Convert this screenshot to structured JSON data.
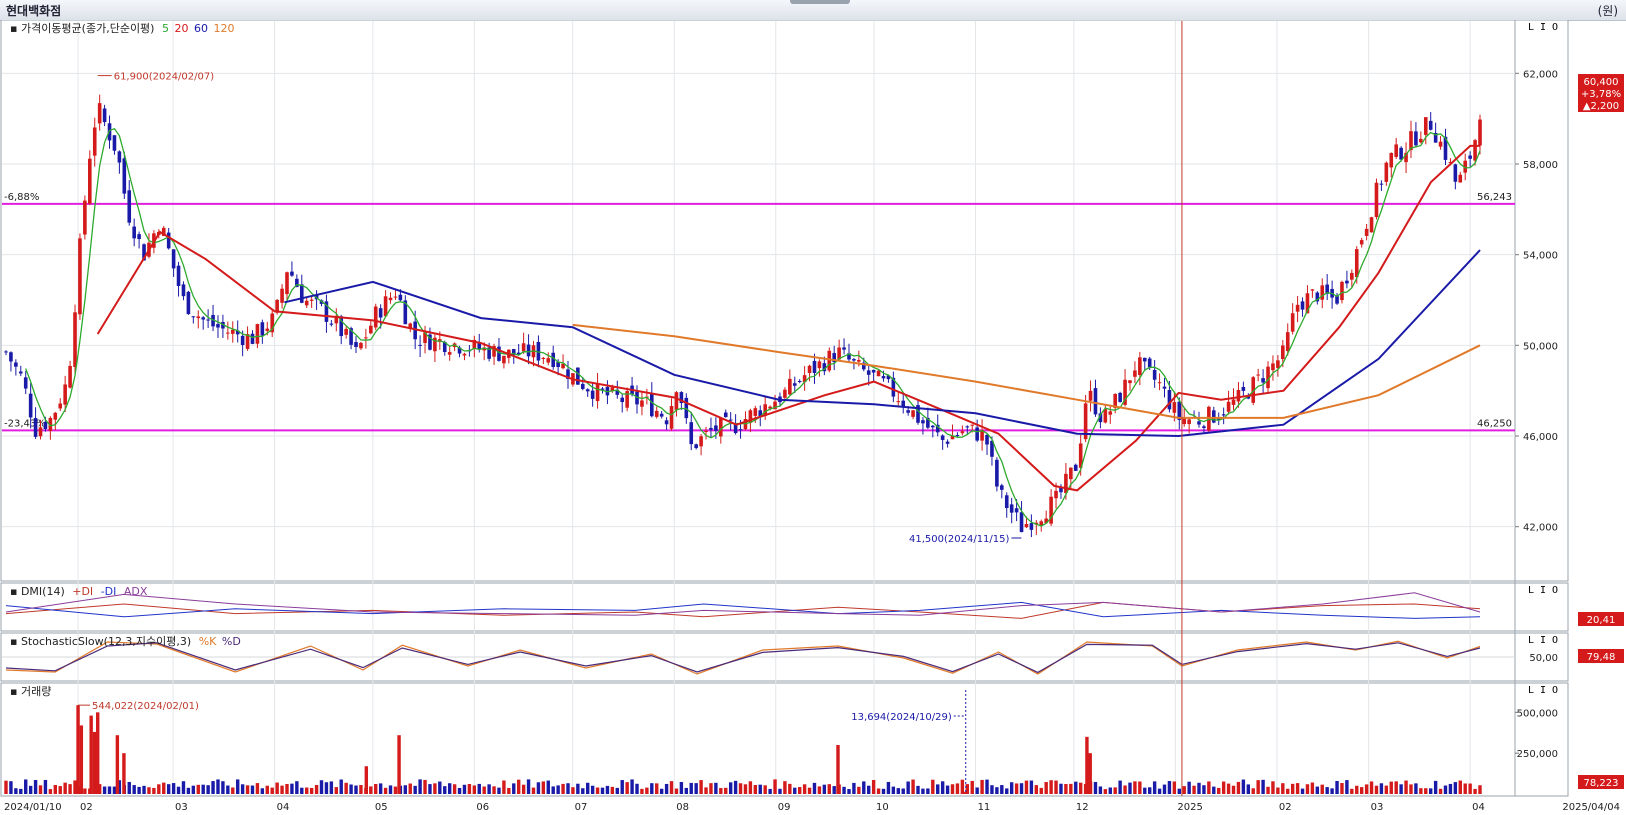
{
  "app": {
    "title": "현대백화점",
    "unit": "(원)",
    "pane_buttons": [
      "L",
      "I",
      "O"
    ]
  },
  "chart_data": {
    "type": "candlestick",
    "title": "가격이동평균(종가,단순이평)",
    "ma_periods": [
      "5",
      "20",
      "60",
      "120"
    ],
    "ma_colors": {
      "5": "#2eaa2e",
      "20": "#d41a1a",
      "60": "#1a1aa8",
      "120": "#e07a2a"
    },
    "up_color": "#d41a1a",
    "down_color": "#1a1aa8",
    "price_axis": {
      "ticks": [
        "62,000",
        "58,000",
        "54,000",
        "50,000",
        "46,000",
        "42,000"
      ],
      "ylim": [
        40000,
        64000
      ]
    },
    "x_axis": {
      "start": "2024/01/10",
      "end": "2025/04/04",
      "labels": [
        "2024/01/10",
        "02",
        "03",
        "04",
        "05",
        "06",
        "07",
        "08",
        "09",
        "10",
        "11",
        "12",
        "2025",
        "02",
        "03",
        "04",
        "2025/04/04"
      ],
      "label_dates": [
        "2024-01-10",
        "2024-02-01",
        "2024-03-01",
        "2024-04-01",
        "2024-05-01",
        "2024-06-01",
        "2024-07-01",
        "2024-08-01",
        "2024-09-01",
        "2024-10-01",
        "2024-11-01",
        "2024-12-01",
        "2025-01-01",
        "2025-02-01",
        "2025-03-01",
        "2025-04-01",
        "2025-04-04"
      ]
    },
    "price_points": [
      [
        "2024-01-10",
        49700
      ],
      [
        "2024-01-15",
        48500
      ],
      [
        "2024-01-19",
        46300
      ],
      [
        "2024-01-24",
        46800
      ],
      [
        "2024-01-29",
        48500
      ],
      [
        "2024-02-02",
        55000
      ],
      [
        "2024-02-05",
        59000
      ],
      [
        "2024-02-07",
        60500
      ],
      [
        "2024-02-13",
        58500
      ],
      [
        "2024-02-16",
        56000
      ],
      [
        "2024-02-21",
        54000
      ],
      [
        "2024-02-26",
        55500
      ],
      [
        "2024-03-04",
        52000
      ],
      [
        "2024-03-11",
        51000
      ],
      [
        "2024-03-18",
        50600
      ],
      [
        "2024-03-25",
        50300
      ],
      [
        "2024-04-01",
        51200
      ],
      [
        "2024-04-05",
        53500
      ],
      [
        "2024-04-10",
        52000
      ],
      [
        "2024-04-16",
        51500
      ],
      [
        "2024-04-22",
        50500
      ],
      [
        "2024-04-26",
        49600
      ],
      [
        "2024-05-02",
        51400
      ],
      [
        "2024-05-08",
        52400
      ],
      [
        "2024-05-14",
        50300
      ],
      [
        "2024-05-21",
        50200
      ],
      [
        "2024-05-28",
        50000
      ],
      [
        "2024-06-04",
        49800
      ],
      [
        "2024-06-11",
        49600
      ],
      [
        "2024-06-18",
        49700
      ],
      [
        "2024-06-25",
        49500
      ],
      [
        "2024-07-02",
        48500
      ],
      [
        "2024-07-09",
        47900
      ],
      [
        "2024-07-16",
        47600
      ],
      [
        "2024-07-23",
        47500
      ],
      [
        "2024-07-30",
        46800
      ],
      [
        "2024-08-02",
        48500
      ],
      [
        "2024-08-06",
        45500
      ],
      [
        "2024-08-13",
        46300
      ],
      [
        "2024-08-20",
        46500
      ],
      [
        "2024-08-27",
        47200
      ],
      [
        "2024-09-03",
        47800
      ],
      [
        "2024-09-10",
        48700
      ],
      [
        "2024-09-20",
        49700
      ],
      [
        "2024-09-27",
        48900
      ],
      [
        "2024-10-02",
        48500
      ],
      [
        "2024-10-08",
        47800
      ],
      [
        "2024-10-15",
        46700
      ],
      [
        "2024-10-22",
        45800
      ],
      [
        "2024-10-29",
        46300
      ],
      [
        "2024-11-04",
        46000
      ],
      [
        "2024-11-08",
        43500
      ],
      [
        "2024-11-15",
        42000
      ],
      [
        "2024-11-20",
        42500
      ],
      [
        "2024-11-26",
        43200
      ],
      [
        "2024-12-02",
        44800
      ],
      [
        "2024-12-05",
        48000
      ],
      [
        "2024-12-10",
        46700
      ],
      [
        "2024-12-16",
        48000
      ],
      [
        "2024-12-20",
        49200
      ],
      [
        "2024-12-27",
        48300
      ],
      [
        "2025-01-02",
        46800
      ],
      [
        "2025-01-08",
        46700
      ],
      [
        "2025-01-14",
        47000
      ],
      [
        "2025-01-21",
        47700
      ],
      [
        "2025-02-03",
        49600
      ],
      [
        "2025-02-07",
        51800
      ],
      [
        "2025-02-13",
        52300
      ],
      [
        "2025-02-19",
        52000
      ],
      [
        "2025-02-25",
        54000
      ],
      [
        "2025-03-04",
        57000
      ],
      [
        "2025-03-07",
        58200
      ],
      [
        "2025-03-12",
        58700
      ],
      [
        "2025-03-17",
        59500
      ],
      [
        "2025-03-20",
        59800
      ],
      [
        "2025-03-25",
        58300
      ],
      [
        "2025-03-28",
        57000
      ],
      [
        "2025-04-02",
        58700
      ],
      [
        "2025-04-04",
        60400
      ]
    ],
    "ma_lines": {
      "20": [
        [
          "2024-02-07",
          50500
        ],
        [
          "2024-02-26",
          55000
        ],
        [
          "2024-03-11",
          53800
        ],
        [
          "2024-04-01",
          51500
        ],
        [
          "2024-05-01",
          51100
        ],
        [
          "2024-06-03",
          50100
        ],
        [
          "2024-07-01",
          48500
        ],
        [
          "2024-08-01",
          47700
        ],
        [
          "2024-08-20",
          46500
        ],
        [
          "2024-09-16",
          47800
        ],
        [
          "2024-10-01",
          48400
        ],
        [
          "2024-10-21",
          47200
        ],
        [
          "2024-11-08",
          46100
        ],
        [
          "2024-11-25",
          43800
        ],
        [
          "2024-12-02",
          43600
        ],
        [
          "2024-12-20",
          45800
        ],
        [
          "2025-01-02",
          47900
        ],
        [
          "2025-01-15",
          47600
        ],
        [
          "2025-02-03",
          48000
        ],
        [
          "2025-02-20",
          50800
        ],
        [
          "2025-03-04",
          53200
        ],
        [
          "2025-03-20",
          57200
        ],
        [
          "2025-04-01",
          58800
        ],
        [
          "2025-04-04",
          58800
        ]
      ],
      "60": [
        [
          "2024-04-04",
          51900
        ],
        [
          "2024-05-01",
          52800
        ],
        [
          "2024-06-03",
          51200
        ],
        [
          "2024-07-01",
          50800
        ],
        [
          "2024-08-01",
          48700
        ],
        [
          "2024-09-02",
          47600
        ],
        [
          "2024-10-01",
          47400
        ],
        [
          "2024-11-01",
          47000
        ],
        [
          "2024-12-02",
          46100
        ],
        [
          "2025-01-02",
          46000
        ],
        [
          "2025-02-03",
          46500
        ],
        [
          "2025-03-04",
          49400
        ],
        [
          "2025-04-04",
          54200
        ]
      ],
      "120": [
        [
          "2024-07-01",
          50900
        ],
        [
          "2024-08-01",
          50400
        ],
        [
          "2024-09-02",
          49700
        ],
        [
          "2024-10-01",
          49100
        ],
        [
          "2024-11-01",
          48400
        ],
        [
          "2024-12-02",
          47600
        ],
        [
          "2025-01-02",
          46800
        ],
        [
          "2025-02-03",
          46800
        ],
        [
          "2025-03-04",
          47800
        ],
        [
          "2025-04-04",
          50000
        ]
      ]
    },
    "horizontal_lines": [
      {
        "value": 56243,
        "right_label": "56,243",
        "left_label": "-6,88%"
      },
      {
        "value": 46250,
        "right_label": "46,250",
        "left_label": "-23,43%"
      }
    ],
    "cursor_date": "2025-01-03",
    "annotations": {
      "high": {
        "date": "2024-02-07",
        "value": 61900,
        "text": "61,900(2024/02/07)"
      },
      "low": {
        "date": "2024-11-15",
        "value": 41500,
        "text": "41,500(2024/11/15)"
      }
    },
    "last_price_box": {
      "price": "60,400",
      "change_pct": "+3,78%",
      "change": "▲2,200"
    },
    "dmi": {
      "title": "DMI(14)",
      "series": [
        "+DI",
        "-DI",
        "ADX"
      ],
      "colors": [
        "#c0392b",
        "#2134c9",
        "#8a3d9a"
      ],
      "last_value": "20,41",
      "pdi": [
        [
          "2024-01-10",
          18
        ],
        [
          "2024-02-15",
          30
        ],
        [
          "2024-03-20",
          18
        ],
        [
          "2024-05-01",
          22
        ],
        [
          "2024-06-10",
          16
        ],
        [
          "2024-07-20",
          20
        ],
        [
          "2024-08-10",
          14
        ],
        [
          "2024-09-20",
          26
        ],
        [
          "2024-10-15",
          20
        ],
        [
          "2024-11-15",
          12
        ],
        [
          "2024-12-10",
          32
        ],
        [
          "2025-01-15",
          20
        ],
        [
          "2025-02-15",
          28
        ],
        [
          "2025-03-15",
          30
        ],
        [
          "2025-04-04",
          24
        ]
      ],
      "mdi": [
        [
          "2024-01-10",
          28
        ],
        [
          "2024-02-15",
          14
        ],
        [
          "2024-03-20",
          24
        ],
        [
          "2024-05-01",
          18
        ],
        [
          "2024-06-10",
          24
        ],
        [
          "2024-07-20",
          22
        ],
        [
          "2024-08-10",
          30
        ],
        [
          "2024-09-20",
          18
        ],
        [
          "2024-10-15",
          22
        ],
        [
          "2024-11-15",
          32
        ],
        [
          "2024-12-10",
          14
        ],
        [
          "2025-01-15",
          22
        ],
        [
          "2025-02-15",
          16
        ],
        [
          "2025-03-15",
          12
        ],
        [
          "2025-04-04",
          14
        ]
      ],
      "adx": [
        [
          "2024-01-10",
          20
        ],
        [
          "2024-02-15",
          42
        ],
        [
          "2024-03-20",
          30
        ],
        [
          "2024-05-01",
          20
        ],
        [
          "2024-06-10",
          18
        ],
        [
          "2024-07-20",
          16
        ],
        [
          "2024-08-10",
          22
        ],
        [
          "2024-09-20",
          18
        ],
        [
          "2024-10-15",
          16
        ],
        [
          "2024-11-15",
          28
        ],
        [
          "2024-12-10",
          32
        ],
        [
          "2025-01-15",
          20
        ],
        [
          "2025-02-15",
          30
        ],
        [
          "2025-03-15",
          44
        ],
        [
          "2025-04-04",
          20
        ]
      ]
    },
    "stochastic": {
      "title": "StochasticSlow(12,3,지수이평,3)",
      "series": [
        "%K",
        "%D"
      ],
      "colors": [
        "#e07a2a",
        "#4a2a7a"
      ],
      "ticks": [
        "50,00"
      ],
      "last_value": "79,48",
      "k": [
        [
          "2024-01-10",
          20
        ],
        [
          "2024-01-25",
          15
        ],
        [
          "2024-02-10",
          90
        ],
        [
          "2024-02-25",
          85
        ],
        [
          "2024-03-20",
          15
        ],
        [
          "2024-04-12",
          80
        ],
        [
          "2024-04-28",
          20
        ],
        [
          "2024-05-10",
          82
        ],
        [
          "2024-05-30",
          30
        ],
        [
          "2024-06-15",
          70
        ],
        [
          "2024-07-05",
          25
        ],
        [
          "2024-07-25",
          60
        ],
        [
          "2024-08-08",
          10
        ],
        [
          "2024-08-28",
          70
        ],
        [
          "2024-09-20",
          80
        ],
        [
          "2024-10-10",
          50
        ],
        [
          "2024-10-25",
          12
        ],
        [
          "2024-11-08",
          65
        ],
        [
          "2024-11-20",
          10
        ],
        [
          "2024-12-05",
          90
        ],
        [
          "2024-12-25",
          80
        ],
        [
          "2025-01-03",
          30
        ],
        [
          "2025-01-20",
          70
        ],
        [
          "2025-02-10",
          90
        ],
        [
          "2025-02-25",
          70
        ],
        [
          "2025-03-10",
          92
        ],
        [
          "2025-03-25",
          50
        ],
        [
          "2025-04-04",
          79
        ]
      ],
      "d": [
        [
          "2024-01-10",
          25
        ],
        [
          "2024-01-25",
          18
        ],
        [
          "2024-02-10",
          80
        ],
        [
          "2024-02-25",
          88
        ],
        [
          "2024-03-20",
          20
        ],
        [
          "2024-04-12",
          72
        ],
        [
          "2024-04-28",
          26
        ],
        [
          "2024-05-10",
          75
        ],
        [
          "2024-05-30",
          34
        ],
        [
          "2024-06-15",
          65
        ],
        [
          "2024-07-05",
          30
        ],
        [
          "2024-07-25",
          56
        ],
        [
          "2024-08-08",
          15
        ],
        [
          "2024-08-28",
          64
        ],
        [
          "2024-09-20",
          76
        ],
        [
          "2024-10-10",
          54
        ],
        [
          "2024-10-25",
          16
        ],
        [
          "2024-11-08",
          60
        ],
        [
          "2024-11-20",
          14
        ],
        [
          "2024-12-05",
          84
        ],
        [
          "2024-12-25",
          82
        ],
        [
          "2025-01-03",
          34
        ],
        [
          "2025-01-20",
          66
        ],
        [
          "2025-02-10",
          86
        ],
        [
          "2025-02-25",
          72
        ],
        [
          "2025-03-10",
          88
        ],
        [
          "2025-03-25",
          54
        ],
        [
          "2025-04-04",
          75
        ]
      ]
    },
    "volume": {
      "title": "거래량",
      "ticks": [
        "500,000",
        "250,000"
      ],
      "ylim": [
        0,
        600000
      ],
      "last_value": "78,223",
      "spikes": [
        [
          "2024-02-01",
          544022
        ],
        [
          "2024-02-02",
          420000
        ],
        [
          "2024-02-05",
          480000
        ],
        [
          "2024-02-06",
          380000
        ],
        [
          "2024-02-07",
          500000
        ],
        [
          "2024-02-13",
          360000
        ],
        [
          "2024-02-15",
          250000
        ],
        [
          "2024-04-29",
          170000
        ],
        [
          "2024-05-09",
          360000
        ],
        [
          "2024-09-20",
          300000
        ],
        [
          "2024-10-29",
          13694
        ],
        [
          "2024-12-05",
          350000
        ],
        [
          "2024-12-06",
          250000
        ]
      ],
      "annotations": {
        "max": {
          "date": "2024-02-01",
          "value": 544022,
          "text": "544,022(2024/02/01)"
        },
        "min": {
          "date": "2024-10-29",
          "value": 13694,
          "text": "13,694(2024/10/29)"
        }
      }
    }
  }
}
